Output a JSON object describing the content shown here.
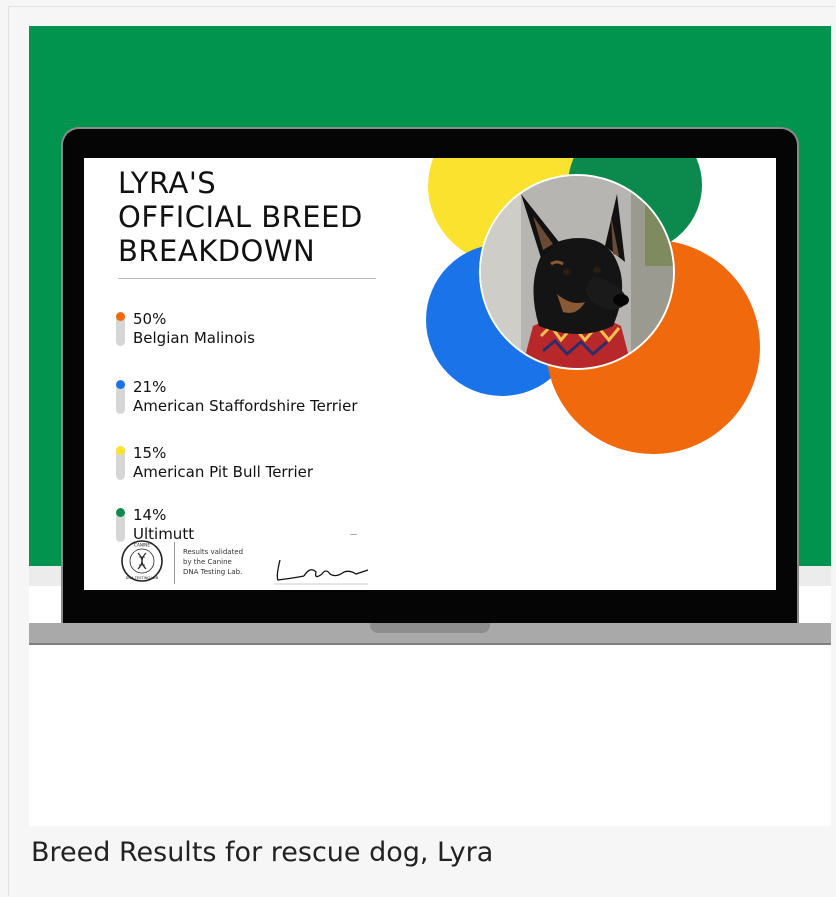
{
  "caption": "Breed Results for rescue dog, Lyra",
  "report": {
    "title_lines": [
      "LYRA'S",
      "OFFICIAL BREED",
      "BREAKDOWN"
    ],
    "breeds": [
      {
        "percent_label": "50%",
        "percent": 50,
        "name": "Belgian Malinois",
        "color": "#f06a0d"
      },
      {
        "percent_label": "21%",
        "percent": 21,
        "name": "American Staffordshire Terrier",
        "color": "#1a73e8"
      },
      {
        "percent_label": "15%",
        "percent": 15,
        "name": "American Pit Bull Terrier",
        "color": "#fbe22f"
      },
      {
        "percent_label": "14%",
        "percent": 14,
        "name": "Ultimutt",
        "color": "#0c8a4d"
      }
    ],
    "lab_logo_text": "CANINE DNA TESTING LAB",
    "validation_lines": [
      "Results validated",
      "by the Canine",
      "DNA Testing Lab."
    ],
    "signature": "signature"
  },
  "colors": {
    "background_green": "#00944f",
    "laptop_bezel": "#050505",
    "laptop_base": "#a9a9a9"
  },
  "icons": {
    "lab_logo": "dna-helix-seal-icon",
    "dog_photo": "dog-portrait-image"
  }
}
